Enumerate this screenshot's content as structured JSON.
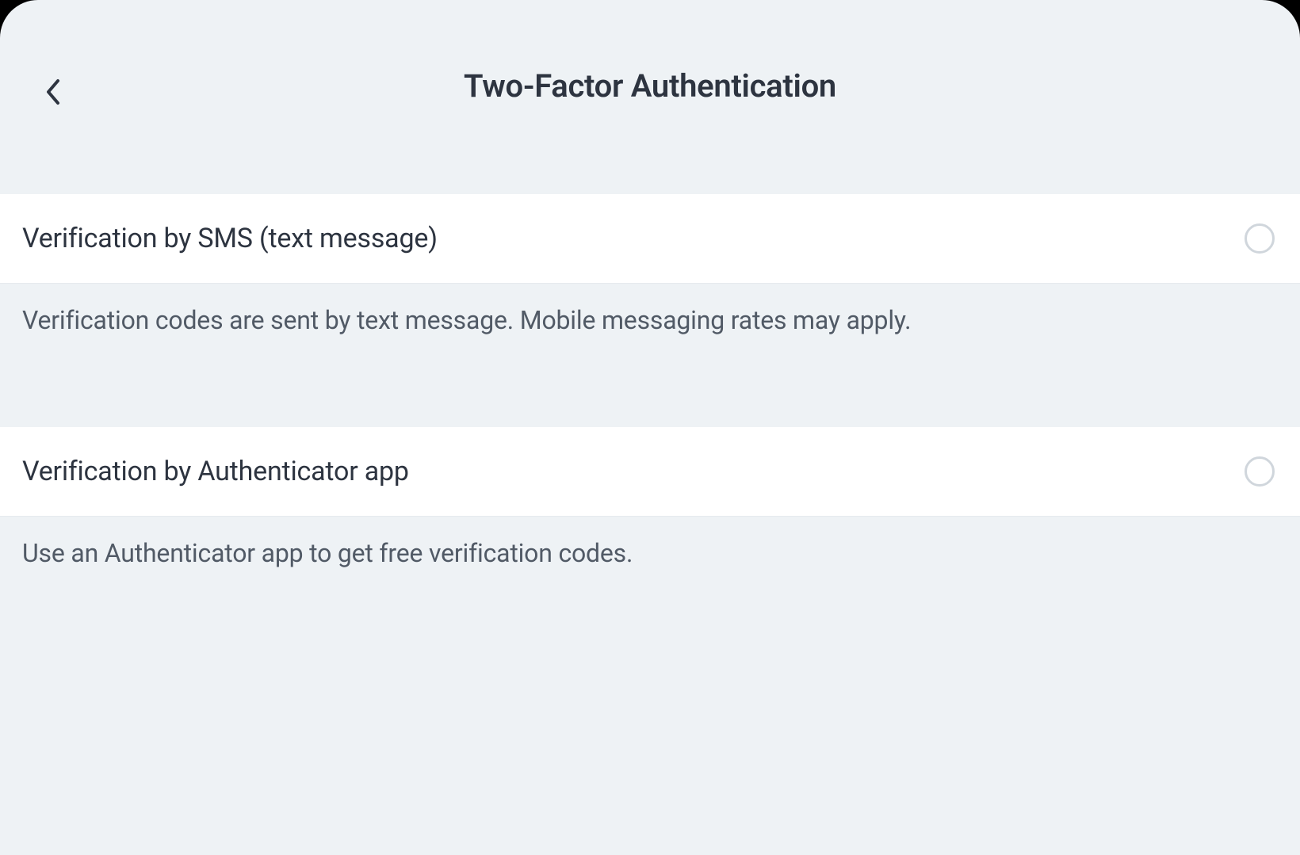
{
  "header": {
    "title": "Two-Factor Authentication"
  },
  "options": [
    {
      "label": "Verification by SMS (text message)",
      "description": "Verification codes are sent by text message. Mobile messaging rates may apply."
    },
    {
      "label": "Verification by Authenticator app",
      "description": "Use an Authenticator app to get free verification codes."
    }
  ]
}
